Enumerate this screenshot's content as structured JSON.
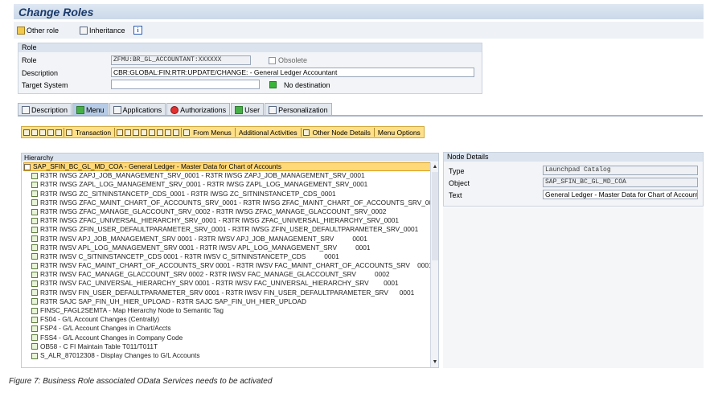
{
  "title": "Change Roles",
  "app_toolbar": {
    "other_role": "Other role",
    "inheritance": "Inheritance",
    "info": "i"
  },
  "role": {
    "section": "Role",
    "role_label": "Role",
    "role_value": "ZFMU:BR_GL_ACCOUNTANT:XXXXXX",
    "obsolete_label": "Obsolete",
    "description_label": "Description",
    "description_value": "CBR:GLOBAL:FIN:RTR:UPDATE/CHANGE: - General Ledger Accountant",
    "target_label": "Target System",
    "target_value": "",
    "no_destination": "No destination"
  },
  "tabs": [
    {
      "label": "Description"
    },
    {
      "label": "Menu"
    },
    {
      "label": "Applications"
    },
    {
      "label": "Authorizations"
    },
    {
      "label": "User"
    },
    {
      "label": "Personalization"
    }
  ],
  "menu_toolbar": {
    "transaction": "Transaction",
    "from_menus": "From Menus",
    "additional": "Additional Activities",
    "other_node": "Other Node Details",
    "menu_options": "Menu Options"
  },
  "hierarchy": {
    "header": "Hierarchy",
    "root": "SAP_SFIN_BC_GL_MD_COA - General Ledger - Master Data for Chart of Accounts",
    "items": [
      "R3TR IWSG ZAPJ_JOB_MANAGEMENT_SRV_0001 - R3TR IWSG ZAPJ_JOB_MANAGEMENT_SRV_0001",
      "R3TR IWSG ZAPL_LOG_MANAGEMENT_SRV_0001 - R3TR IWSG ZAPL_LOG_MANAGEMENT_SRV_0001",
      "R3TR IWSG ZC_SITNINSTANCETP_CDS_0001 - R3TR IWSG ZC_SITNINSTANCETP_CDS_0001",
      "R3TR IWSG ZFAC_MAINT_CHART_OF_ACCOUNTS_SRV_0001 - R3TR IWSG ZFAC_MAINT_CHART_OF_ACCOUNTS_SRV_0001",
      "R3TR IWSG ZFAC_MANAGE_GLACCOUNT_SRV_0002 - R3TR IWSG ZFAC_MANAGE_GLACCOUNT_SRV_0002",
      "R3TR IWSG ZFAC_UNIVERSAL_HIERARCHY_SRV_0001 - R3TR IWSG ZFAC_UNIVERSAL_HIERARCHY_SRV_0001",
      "R3TR IWSG ZFIN_USER_DEFAULTPARAMETER_SRV_0001 - R3TR IWSG ZFIN_USER_DEFAULTPARAMETER_SRV_0001",
      "R3TR IWSV APJ_JOB_MANAGEMENT_SRV 0001 - R3TR IWSV APJ_JOB_MANAGEMENT_SRV          0001",
      "R3TR IWSV APL_LOG_MANAGEMENT_SRV 0001 - R3TR IWSV APL_LOG_MANAGEMENT_SRV          0001",
      "R3TR IWSV C_SITNINSTANCETP_CDS 0001 - R3TR IWSV C_SITNINSTANCETP_CDS          0001",
      "R3TR IWSV FAC_MAINT_CHART_OF_ACCOUNTS_SRV 0001 - R3TR IWSV FAC_MAINT_CHART_OF_ACCOUNTS_SRV    0001",
      "R3TR IWSV FAC_MANAGE_GLACCOUNT_SRV 0002 - R3TR IWSV FAC_MANAGE_GLACCOUNT_SRV          0002",
      "R3TR IWSV FAC_UNIVERSAL_HIERARCHY_SRV 0001 - R3TR IWSV FAC_UNIVERSAL_HIERARCHY_SRV        0001",
      "R3TR IWSV FIN_USER_DEFAULTPARAMETER_SRV 0001 - R3TR IWSV FIN_USER_DEFAULTPARAMETER_SRV      0001",
      "R3TR SAJC SAP_FIN_UH_HIER_UPLOAD - R3TR SAJC SAP_FIN_UH_HIER_UPLOAD",
      "FINSC_FAGL2SEMTA - Map Hierarchy Node to Semantic Tag",
      "FS04 - G/L Account Changes (Centrally)",
      "FSP4 - G/L Account Changes in Chart/Accts",
      "FSS4 - G/L Account Changes in Company Code",
      "OB58 - C FI Maintain Table T011/T011T",
      "S_ALR_87012308 - Display Changes to G/L Accounts"
    ]
  },
  "node_details": {
    "header": "Node Details",
    "type_label": "Type",
    "type_value": "Launchpad Catalog",
    "object_label": "Object",
    "object_value": "SAP_SFIN_BC_GL_MD_COA",
    "text_label": "Text",
    "text_value": "General Ledger - Master Data for Chart of Accounts"
  },
  "caption": "Figure 7: Business Role associated OData Services needs to be activated",
  "colors": {
    "title": "#1a3a6a",
    "active_tab": "#b6cbe6",
    "root_highlight": "#ffd978",
    "toolbar": "#ffe08a"
  }
}
